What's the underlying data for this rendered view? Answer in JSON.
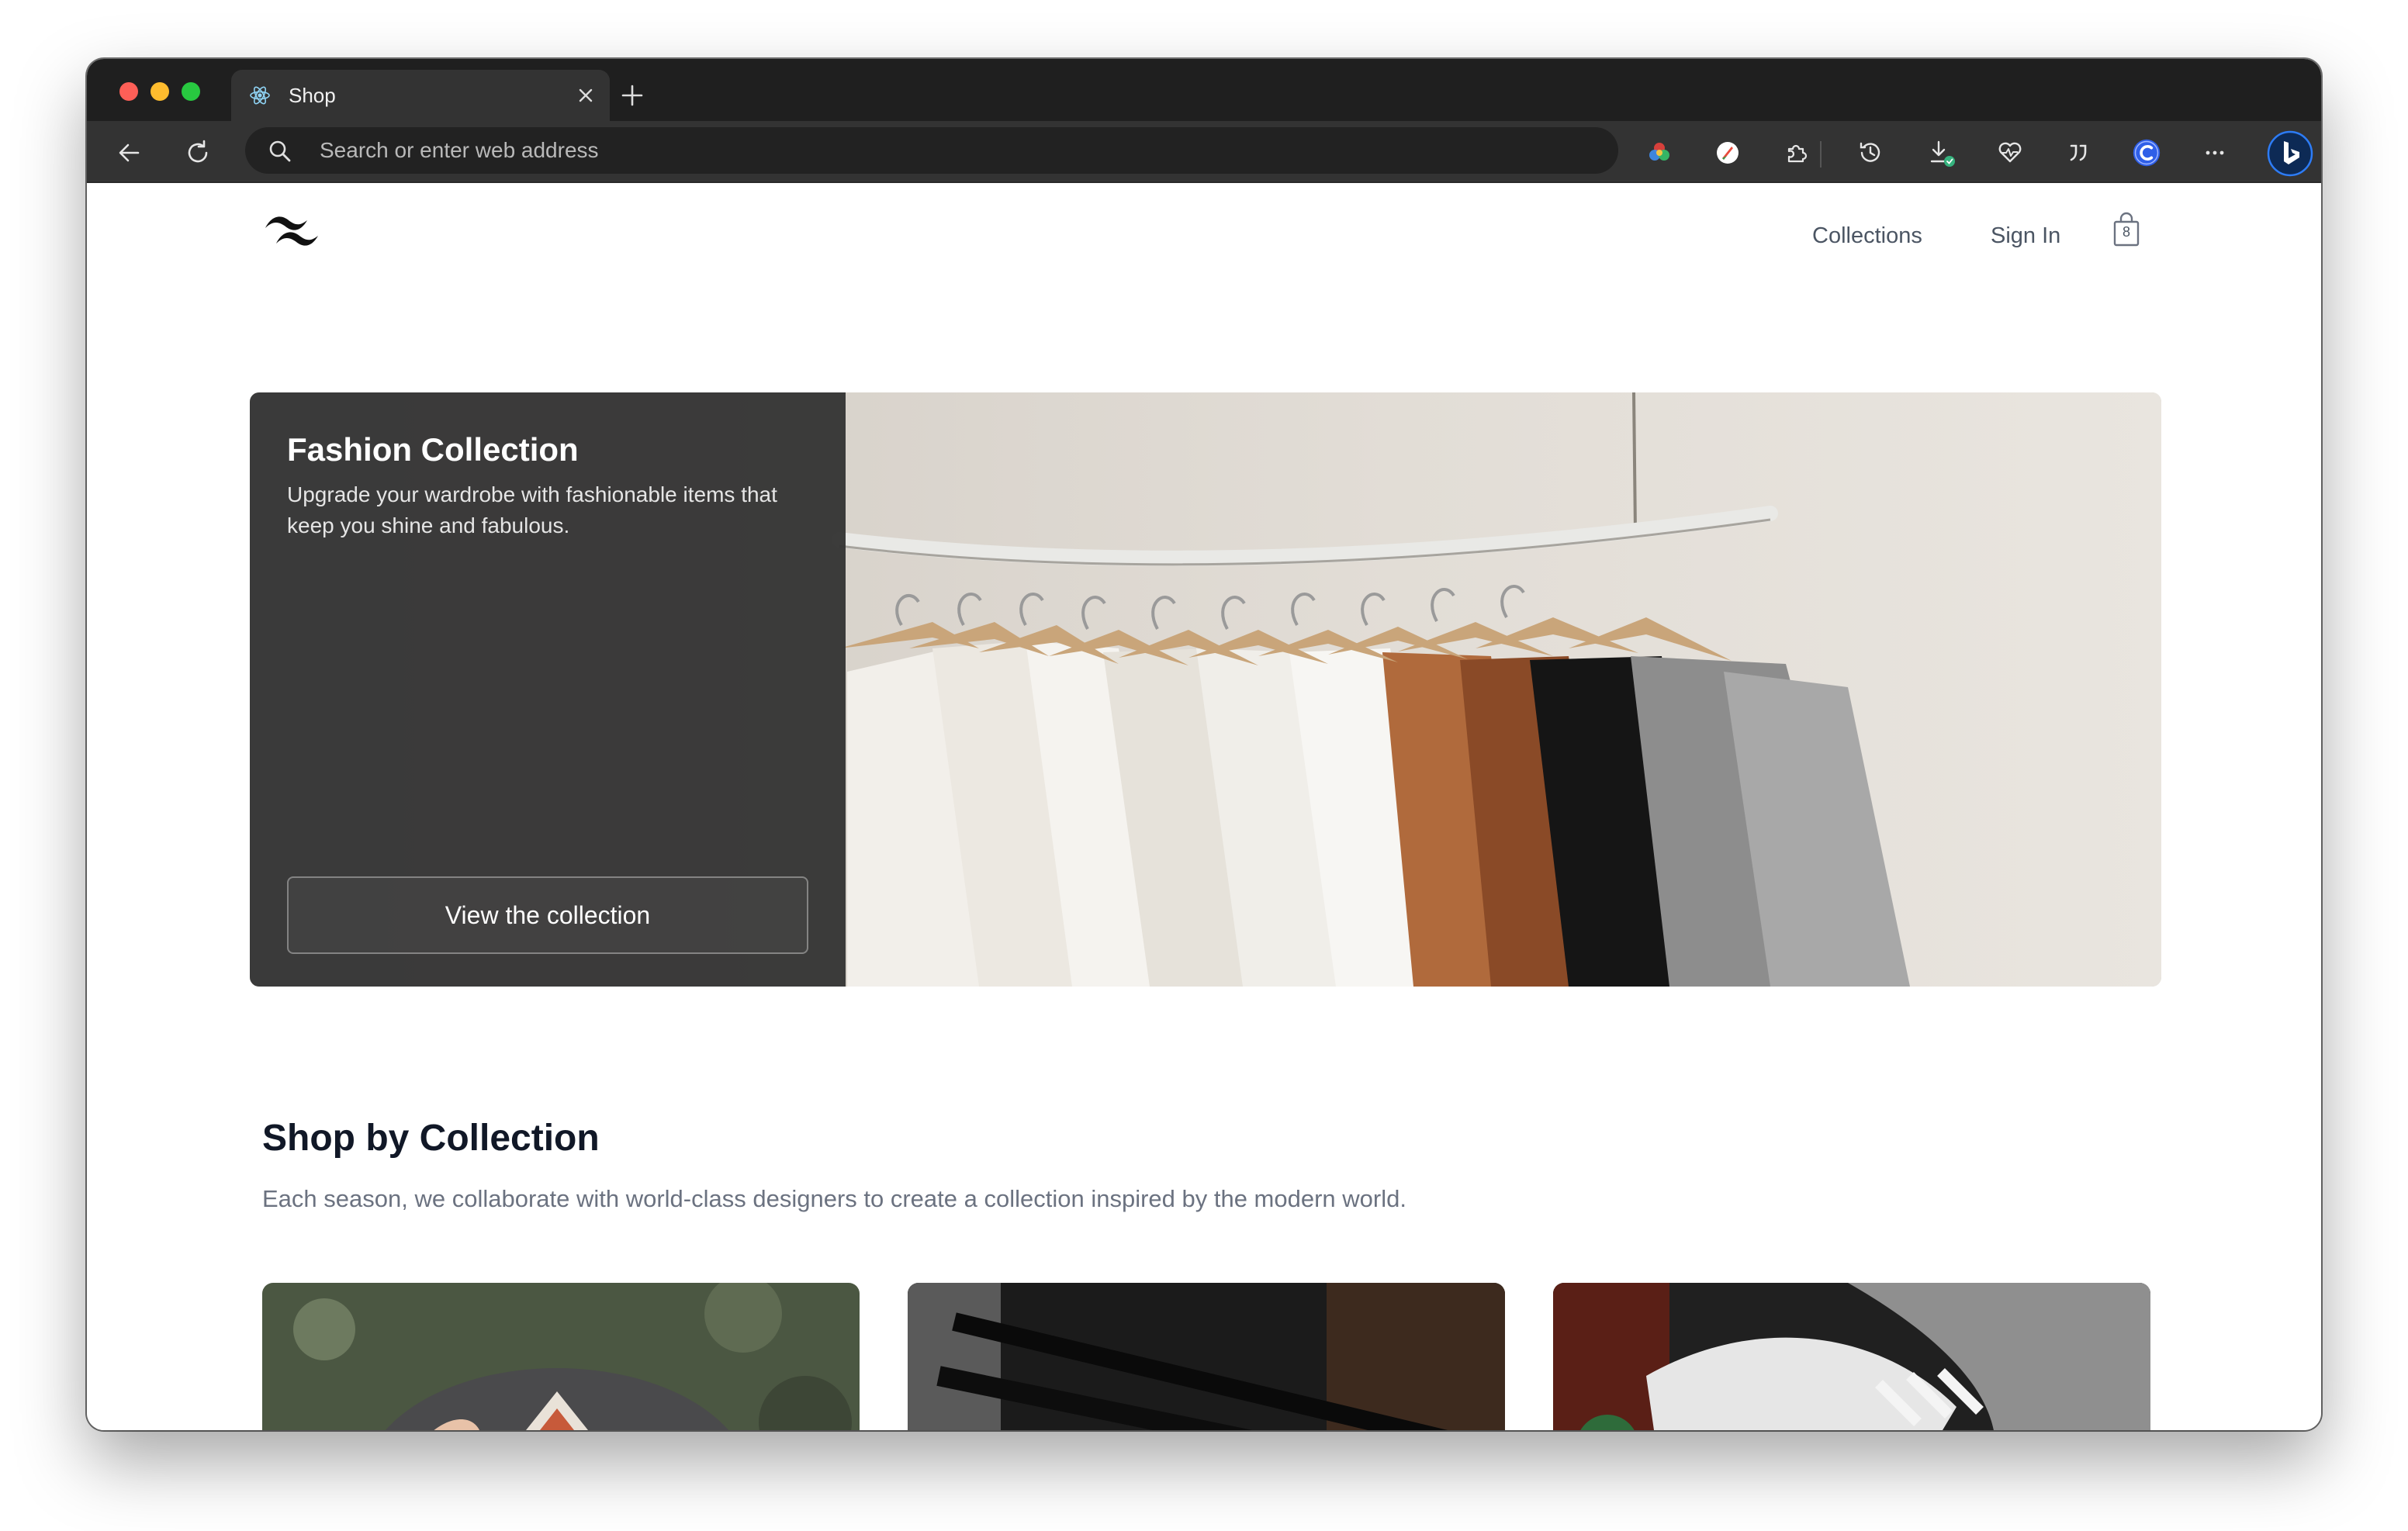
{
  "browser": {
    "tab": {
      "title": "Shop",
      "favicon": "react-icon"
    },
    "address_bar": {
      "placeholder": "Search or enter web address",
      "value": ""
    },
    "toolbar_icons": [
      "back-icon",
      "reload-icon",
      "search-icon",
      "color-extension-icon",
      "compass-extension-icon",
      "puzzle-extensions-icon",
      "history-icon",
      "downloads-icon",
      "heart-rate-icon",
      "quote-icon",
      "profile-c-icon",
      "more-icon",
      "bing-icon"
    ]
  },
  "site": {
    "nav": {
      "collections_label": "Collections",
      "signin_label": "Sign In",
      "cart_count": "8"
    },
    "hero": {
      "title": "Fashion Collection",
      "description": "Upgrade your wardrobe with fashionable items that keep you shine and fabulous.",
      "button_label": "View the collection"
    },
    "shop_by_collection": {
      "title": "Shop by Collection",
      "description": "Each season, we collaborate with world-class designers to create a collection inspired by the modern world."
    }
  },
  "colors": {
    "chrome_dark": "#1f1f1f",
    "toolbar": "#333333",
    "hero_panel": "#343434",
    "heading": "#111827",
    "body_text": "#6b7280"
  }
}
